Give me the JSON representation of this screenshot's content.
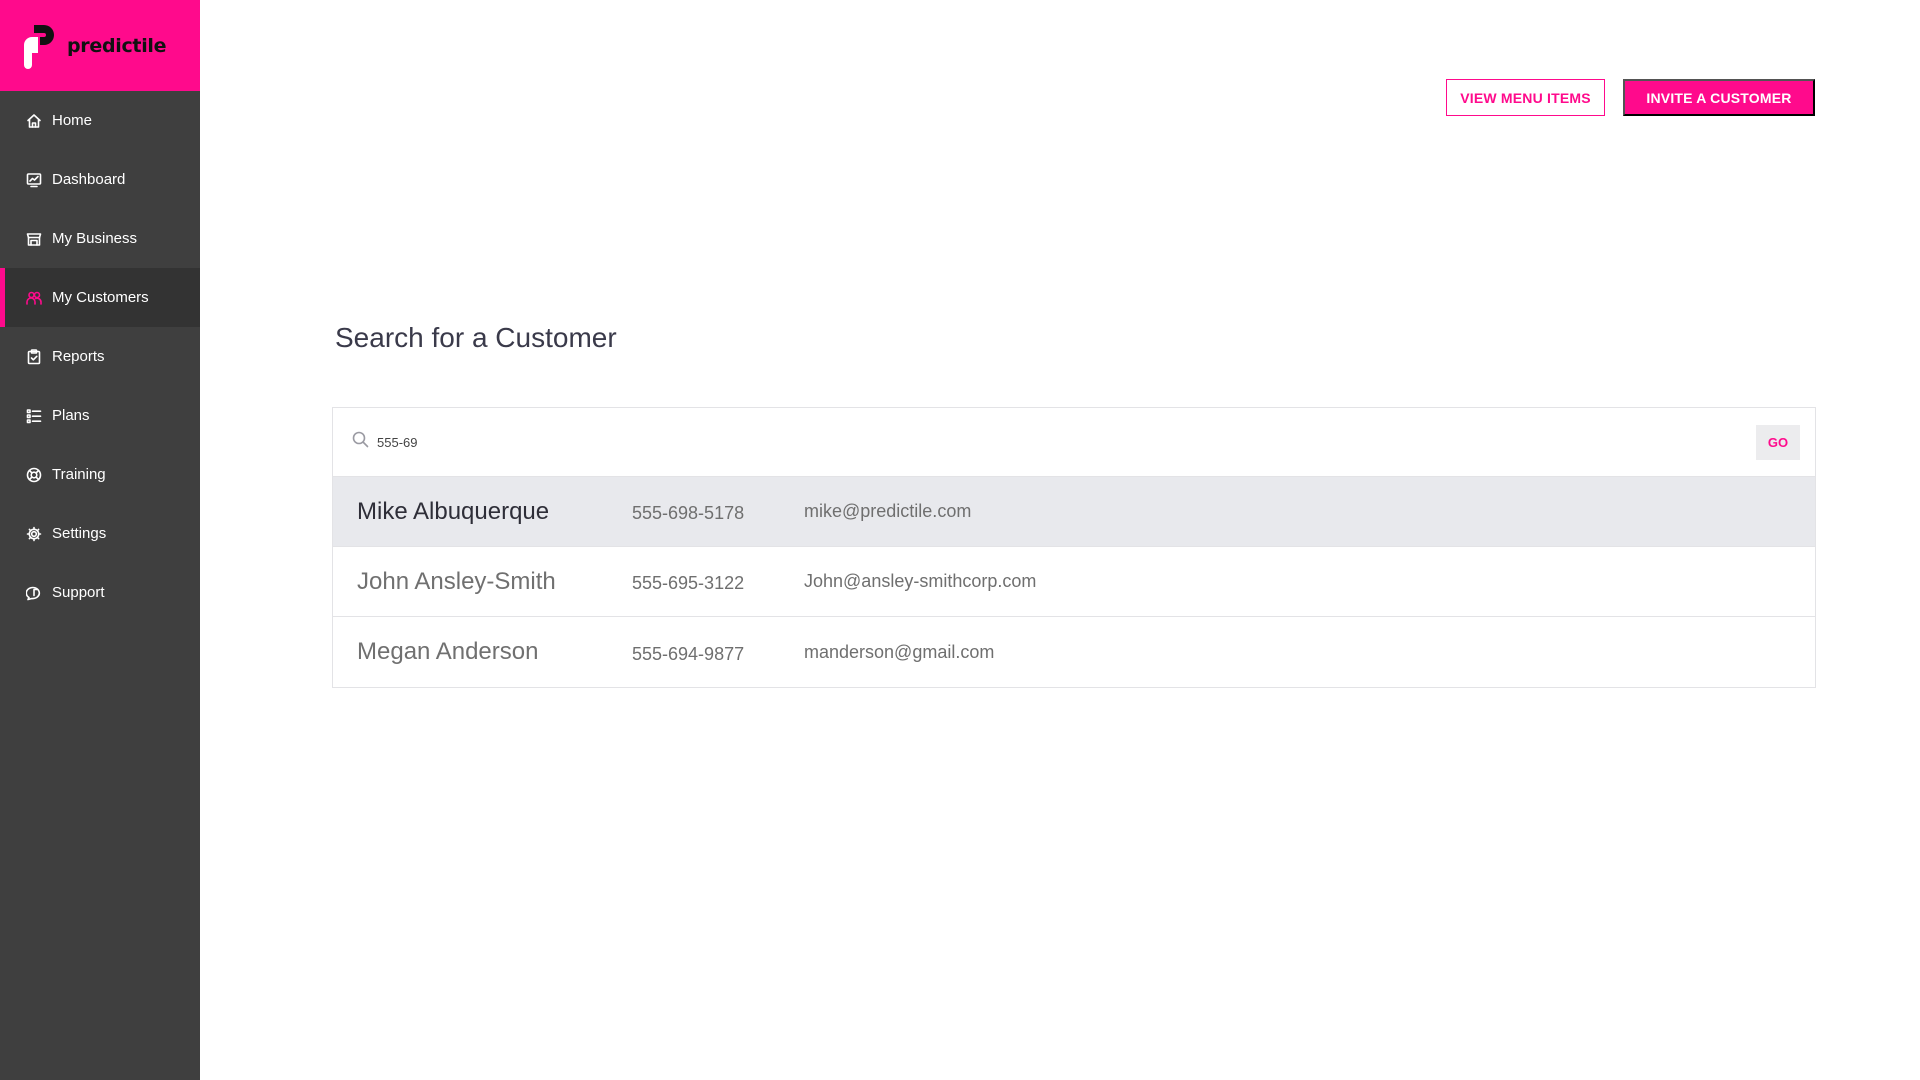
{
  "brand": {
    "name": "predictile",
    "accent": "#ff0a8c"
  },
  "sidebar": {
    "items": [
      {
        "label": "Home",
        "icon": "home-icon"
      },
      {
        "label": "Dashboard",
        "icon": "dashboard-icon"
      },
      {
        "label": "My Business",
        "icon": "store-icon"
      },
      {
        "label": "My Customers",
        "icon": "users-icon",
        "active": true
      },
      {
        "label": "Reports",
        "icon": "clipboard-icon"
      },
      {
        "label": "Plans",
        "icon": "list-icon"
      },
      {
        "label": "Training",
        "icon": "lifebuoy-icon"
      },
      {
        "label": "Settings",
        "icon": "gear-icon"
      },
      {
        "label": "Support",
        "icon": "chat-icon"
      }
    ]
  },
  "header": {
    "view_menu_label": "VIEW MENU ITEMS",
    "invite_label": "INVITE A CUSTOMER"
  },
  "main": {
    "title": "Search for a Customer",
    "search": {
      "value": "555-69",
      "go_label": "GO"
    },
    "results": [
      {
        "name": "Mike Albuquerque",
        "phone": "555-698-5178",
        "email": "mike@predictile.com",
        "highlighted": true
      },
      {
        "name": "John Ansley-Smith",
        "phone": "555-695-3122",
        "email": "John@ansley-smithcorp.com"
      },
      {
        "name": "Megan Anderson",
        "phone": "555-694-9877",
        "email": "manderson@gmail.com"
      }
    ]
  }
}
